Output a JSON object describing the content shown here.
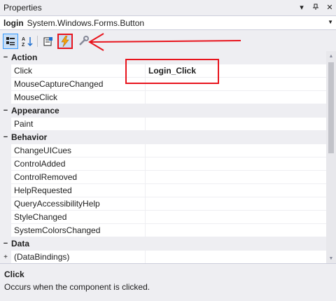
{
  "window": {
    "title": "Properties",
    "controls": [
      "pin-dropdown-icon",
      "pin-icon",
      "close-icon"
    ]
  },
  "object_selector": {
    "name": "login",
    "type": "System.Windows.Forms.Button"
  },
  "toolbar": {
    "buttons": [
      {
        "icon": "categorized-icon",
        "active": true
      },
      {
        "icon": "alphabetical-icon",
        "active": false
      },
      {
        "icon": "properties-icon",
        "active": false
      },
      {
        "icon": "events-icon",
        "active": true
      },
      {
        "icon": "property-pages-icon",
        "active": false
      }
    ]
  },
  "grid": {
    "categories": [
      {
        "label": "Action",
        "toggle": "−",
        "items": [
          {
            "name": "Click",
            "value": "Login_Click"
          },
          {
            "name": "MouseCaptureChanged",
            "value": ""
          },
          {
            "name": "MouseClick",
            "value": ""
          }
        ]
      },
      {
        "label": "Appearance",
        "toggle": "−",
        "items": [
          {
            "name": "Paint",
            "value": ""
          }
        ]
      },
      {
        "label": "Behavior",
        "toggle": "−",
        "items": [
          {
            "name": "ChangeUICues",
            "value": ""
          },
          {
            "name": "ControlAdded",
            "value": ""
          },
          {
            "name": "ControlRemoved",
            "value": ""
          },
          {
            "name": "HelpRequested",
            "value": ""
          },
          {
            "name": "QueryAccessibilityHelp",
            "value": ""
          },
          {
            "name": "StyleChanged",
            "value": ""
          },
          {
            "name": "SystemColorsChanged",
            "value": ""
          }
        ]
      },
      {
        "label": "Data",
        "toggle": "−",
        "items": [
          {
            "name": "(DataBindings)",
            "value": "",
            "expand": "+"
          }
        ]
      }
    ]
  },
  "description": {
    "title": "Click",
    "text": "Occurs when the component is clicked."
  },
  "colors": {
    "highlight": "#e8141d",
    "accent": "#3399ff"
  }
}
